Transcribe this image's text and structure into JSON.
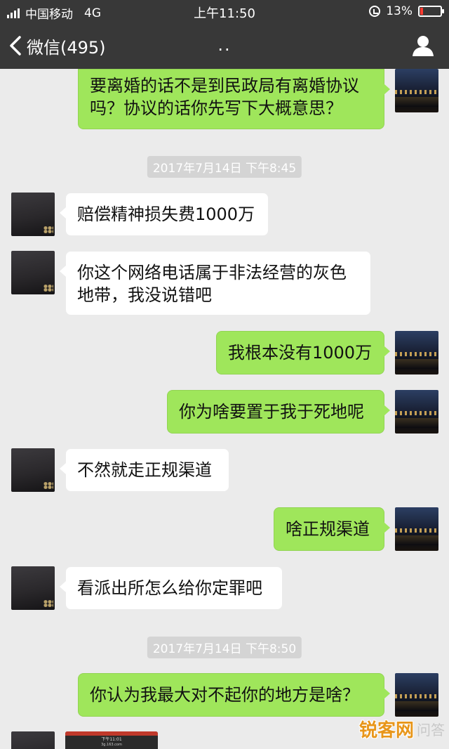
{
  "status_bar": {
    "carrier": "中国移动",
    "network": "4G",
    "time": "上午11:50",
    "battery": "13%",
    "battery_level": 0.13
  },
  "nav": {
    "back_label": "微信(495)",
    "title": ".."
  },
  "messages": [
    {
      "dir": "out",
      "text": "要离婚的话不是到民政局有离婚协议吗？协议的话你先写下大概意思？"
    },
    {
      "type": "time",
      "text": "2017年7月14日 下午8:45"
    },
    {
      "dir": "in",
      "text": "赔偿精神损失费1000万"
    },
    {
      "dir": "in",
      "text": "你这个网络电话属于非法经营的灰色地带，我没说错吧"
    },
    {
      "dir": "out",
      "text": "我根本没有1000万"
    },
    {
      "dir": "out",
      "text": "你为啥要置于我于死地呢"
    },
    {
      "dir": "in",
      "text": "不然就走正规渠道"
    },
    {
      "dir": "out",
      "text": "啥正规渠道"
    },
    {
      "dir": "in",
      "text": "看派出所怎么给你定罪吧"
    },
    {
      "type": "time",
      "text": "2017年7月14日 下午8:50"
    },
    {
      "dir": "out",
      "text": "你认为我最大对不起你的地方是啥？"
    }
  ],
  "image_message": {
    "time": "下午11:01",
    "url": "3g.163.com"
  },
  "watermark": {
    "brand": "锐客网",
    "suffix": "问答"
  }
}
